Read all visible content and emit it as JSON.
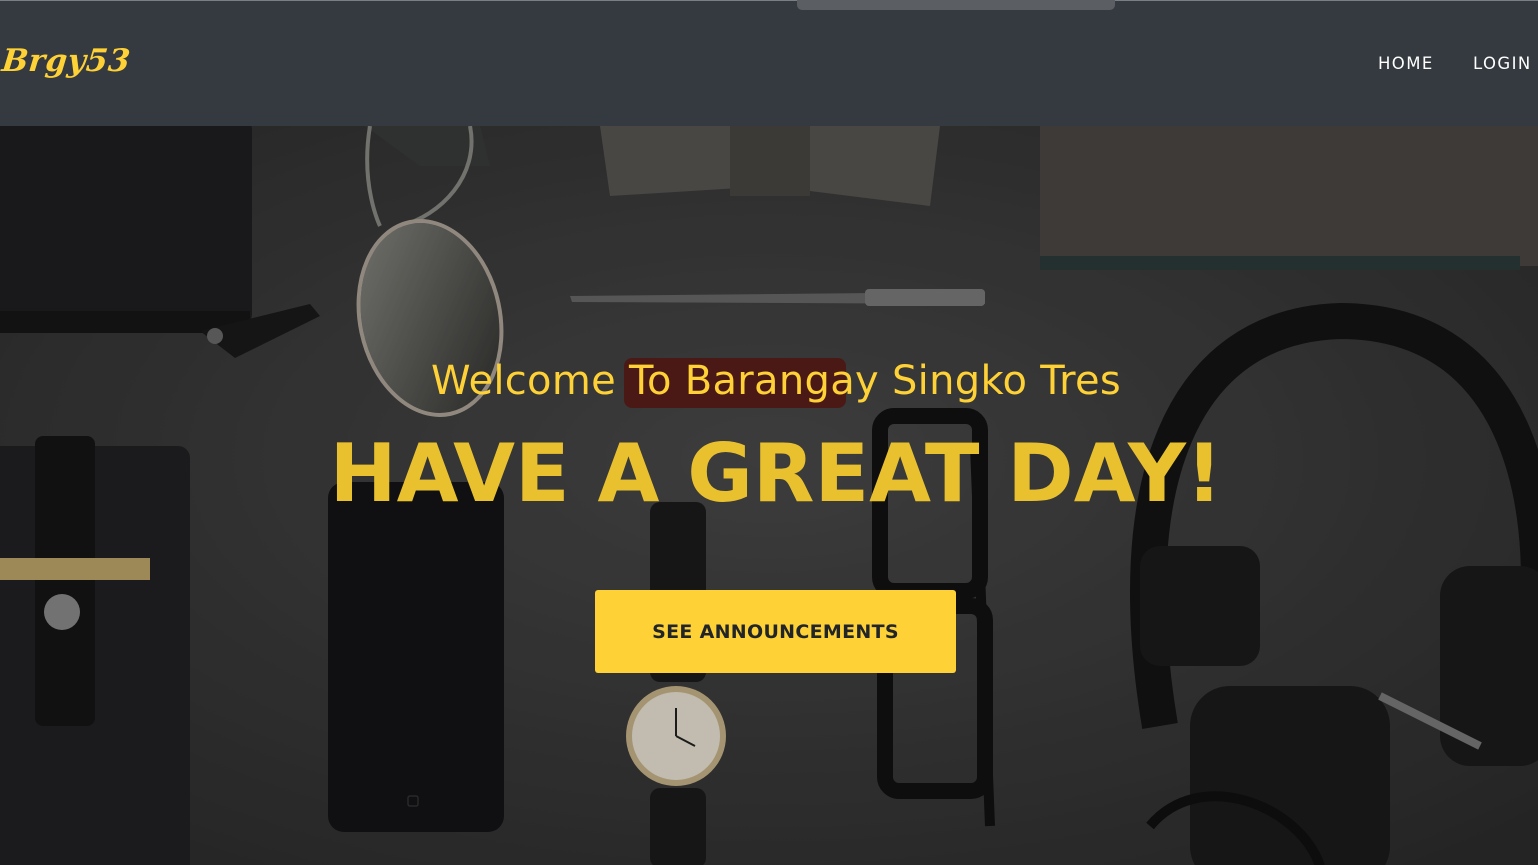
{
  "navbar": {
    "brand": "Brgy53",
    "links": [
      {
        "label": "HOME"
      },
      {
        "label": "LOGIN"
      }
    ]
  },
  "hero": {
    "subheading": "Welcome To Barangay Singko Tres",
    "heading": "HAVE A GREAT DAY!",
    "button_label": "SEE ANNOUNCEMENTS"
  },
  "colors": {
    "navbar_bg": "#343a40",
    "accent": "#fed136",
    "button_text": "#212529",
    "nav_text": "#ffffff"
  }
}
